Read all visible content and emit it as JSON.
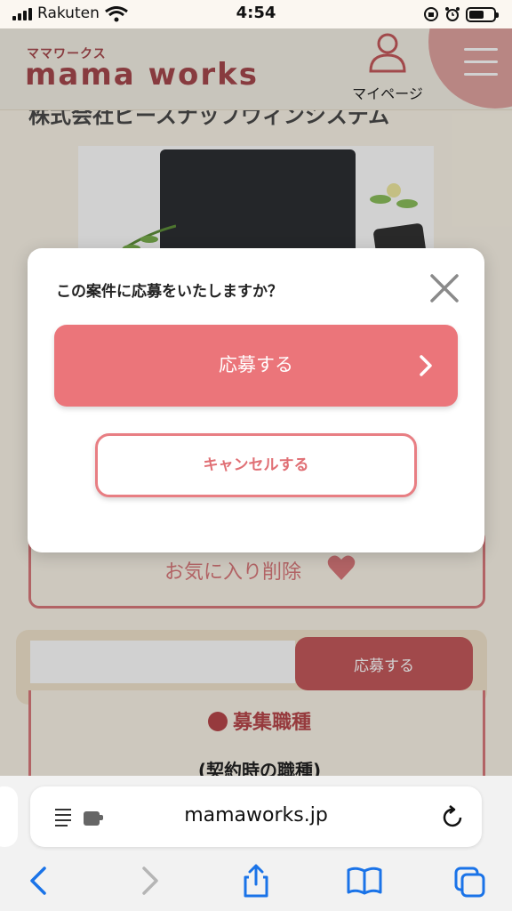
{
  "status": {
    "carrier": "Rakuten",
    "time": "4:54"
  },
  "header": {
    "logo_sub": "ママワークス",
    "logo_main": "mama works",
    "mypage_label": "マイページ"
  },
  "content": {
    "company_name": "株式会社ピースナップウィンシステム",
    "favorite_label": "お気に入り削除",
    "apply_bar_button": "応募する",
    "section_title": "募集職種",
    "section_sub": "(契約時の職種)"
  },
  "modal": {
    "question": "この案件に応募をいたしますか？",
    "apply_label": "応募する",
    "cancel_label": "キャンセルする"
  },
  "browser": {
    "url": "mamaworks.jp"
  },
  "colors": {
    "accent": "#eb757a",
    "brand": "#a7494d"
  }
}
